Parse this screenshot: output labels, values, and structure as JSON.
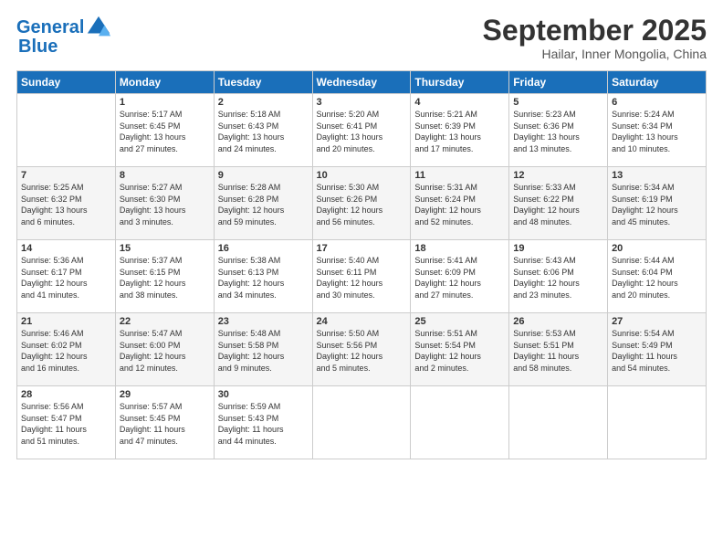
{
  "header": {
    "logo_line1": "General",
    "logo_line2": "Blue",
    "title": "September 2025",
    "location": "Hailar, Inner Mongolia, China"
  },
  "days_of_week": [
    "Sunday",
    "Monday",
    "Tuesday",
    "Wednesday",
    "Thursday",
    "Friday",
    "Saturday"
  ],
  "weeks": [
    [
      {
        "day": "",
        "content": ""
      },
      {
        "day": "1",
        "content": "Sunrise: 5:17 AM\nSunset: 6:45 PM\nDaylight: 13 hours\nand 27 minutes."
      },
      {
        "day": "2",
        "content": "Sunrise: 5:18 AM\nSunset: 6:43 PM\nDaylight: 13 hours\nand 24 minutes."
      },
      {
        "day": "3",
        "content": "Sunrise: 5:20 AM\nSunset: 6:41 PM\nDaylight: 13 hours\nand 20 minutes."
      },
      {
        "day": "4",
        "content": "Sunrise: 5:21 AM\nSunset: 6:39 PM\nDaylight: 13 hours\nand 17 minutes."
      },
      {
        "day": "5",
        "content": "Sunrise: 5:23 AM\nSunset: 6:36 PM\nDaylight: 13 hours\nand 13 minutes."
      },
      {
        "day": "6",
        "content": "Sunrise: 5:24 AM\nSunset: 6:34 PM\nDaylight: 13 hours\nand 10 minutes."
      }
    ],
    [
      {
        "day": "7",
        "content": "Sunrise: 5:25 AM\nSunset: 6:32 PM\nDaylight: 13 hours\nand 6 minutes."
      },
      {
        "day": "8",
        "content": "Sunrise: 5:27 AM\nSunset: 6:30 PM\nDaylight: 13 hours\nand 3 minutes."
      },
      {
        "day": "9",
        "content": "Sunrise: 5:28 AM\nSunset: 6:28 PM\nDaylight: 12 hours\nand 59 minutes."
      },
      {
        "day": "10",
        "content": "Sunrise: 5:30 AM\nSunset: 6:26 PM\nDaylight: 12 hours\nand 56 minutes."
      },
      {
        "day": "11",
        "content": "Sunrise: 5:31 AM\nSunset: 6:24 PM\nDaylight: 12 hours\nand 52 minutes."
      },
      {
        "day": "12",
        "content": "Sunrise: 5:33 AM\nSunset: 6:22 PM\nDaylight: 12 hours\nand 48 minutes."
      },
      {
        "day": "13",
        "content": "Sunrise: 5:34 AM\nSunset: 6:19 PM\nDaylight: 12 hours\nand 45 minutes."
      }
    ],
    [
      {
        "day": "14",
        "content": "Sunrise: 5:36 AM\nSunset: 6:17 PM\nDaylight: 12 hours\nand 41 minutes."
      },
      {
        "day": "15",
        "content": "Sunrise: 5:37 AM\nSunset: 6:15 PM\nDaylight: 12 hours\nand 38 minutes."
      },
      {
        "day": "16",
        "content": "Sunrise: 5:38 AM\nSunset: 6:13 PM\nDaylight: 12 hours\nand 34 minutes."
      },
      {
        "day": "17",
        "content": "Sunrise: 5:40 AM\nSunset: 6:11 PM\nDaylight: 12 hours\nand 30 minutes."
      },
      {
        "day": "18",
        "content": "Sunrise: 5:41 AM\nSunset: 6:09 PM\nDaylight: 12 hours\nand 27 minutes."
      },
      {
        "day": "19",
        "content": "Sunrise: 5:43 AM\nSunset: 6:06 PM\nDaylight: 12 hours\nand 23 minutes."
      },
      {
        "day": "20",
        "content": "Sunrise: 5:44 AM\nSunset: 6:04 PM\nDaylight: 12 hours\nand 20 minutes."
      }
    ],
    [
      {
        "day": "21",
        "content": "Sunrise: 5:46 AM\nSunset: 6:02 PM\nDaylight: 12 hours\nand 16 minutes."
      },
      {
        "day": "22",
        "content": "Sunrise: 5:47 AM\nSunset: 6:00 PM\nDaylight: 12 hours\nand 12 minutes."
      },
      {
        "day": "23",
        "content": "Sunrise: 5:48 AM\nSunset: 5:58 PM\nDaylight: 12 hours\nand 9 minutes."
      },
      {
        "day": "24",
        "content": "Sunrise: 5:50 AM\nSunset: 5:56 PM\nDaylight: 12 hours\nand 5 minutes."
      },
      {
        "day": "25",
        "content": "Sunrise: 5:51 AM\nSunset: 5:54 PM\nDaylight: 12 hours\nand 2 minutes."
      },
      {
        "day": "26",
        "content": "Sunrise: 5:53 AM\nSunset: 5:51 PM\nDaylight: 11 hours\nand 58 minutes."
      },
      {
        "day": "27",
        "content": "Sunrise: 5:54 AM\nSunset: 5:49 PM\nDaylight: 11 hours\nand 54 minutes."
      }
    ],
    [
      {
        "day": "28",
        "content": "Sunrise: 5:56 AM\nSunset: 5:47 PM\nDaylight: 11 hours\nand 51 minutes."
      },
      {
        "day": "29",
        "content": "Sunrise: 5:57 AM\nSunset: 5:45 PM\nDaylight: 11 hours\nand 47 minutes."
      },
      {
        "day": "30",
        "content": "Sunrise: 5:59 AM\nSunset: 5:43 PM\nDaylight: 11 hours\nand 44 minutes."
      },
      {
        "day": "",
        "content": ""
      },
      {
        "day": "",
        "content": ""
      },
      {
        "day": "",
        "content": ""
      },
      {
        "day": "",
        "content": ""
      }
    ]
  ]
}
